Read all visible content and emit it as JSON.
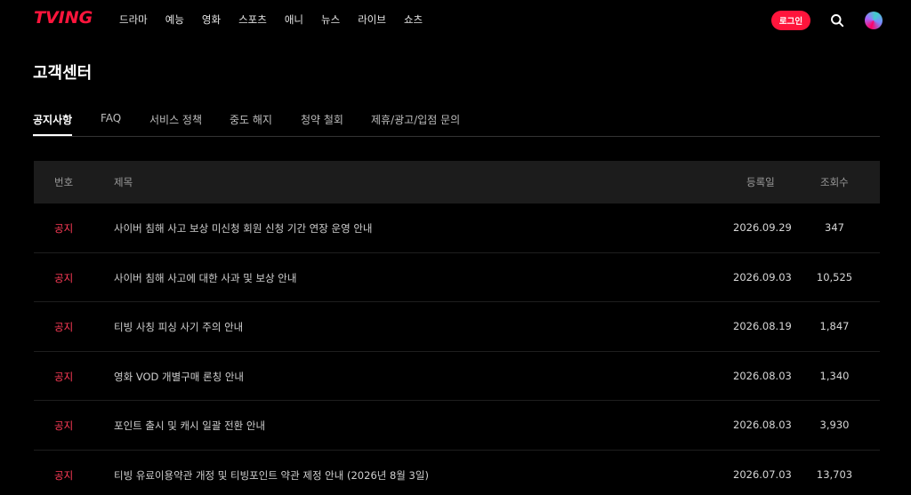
{
  "header": {
    "logo_text": "TVING",
    "nav": [
      "드라마",
      "예능",
      "영화",
      "스포츠",
      "애니",
      "뉴스",
      "라이브",
      "쇼츠"
    ],
    "login_label": "로그인",
    "brand_color": "#ff153c"
  },
  "page_title": "고객센터",
  "tabs": [
    "공지사항",
    "FAQ",
    "서비스 정책",
    "중도 해지",
    "청약 철회",
    "제휴/광고/입점 문의"
  ],
  "table": {
    "headers": {
      "no": "번호",
      "title": "제목",
      "date": "등록일",
      "views": "조회수"
    },
    "rows": [
      {
        "no": "공지",
        "title": "사이버 침해 사고 보상 미신청 회원 신청 기간 연장 운영 안내",
        "date": "2026.09.29",
        "views": "347"
      },
      {
        "no": "공지",
        "title": "사이버 침해 사고에 대한 사과 및 보상 안내",
        "date": "2026.09.03",
        "views": "10,525"
      },
      {
        "no": "공지",
        "title": "티빙 사칭 피싱 사기 주의 안내",
        "date": "2026.08.19",
        "views": "1,847"
      },
      {
        "no": "공지",
        "title": "영화 VOD 개별구매 론칭 안내",
        "date": "2026.08.03",
        "views": "1,340"
      },
      {
        "no": "공지",
        "title": "포인트 출시 및 캐시 일괄 전환 안내",
        "date": "2026.08.03",
        "views": "3,930"
      },
      {
        "no": "공지",
        "title": "티빙 유료이용약관 개정 및 티빙포인트 약관 제정 안내 (2026년 8월 3일)",
        "date": "2026.07.03",
        "views": "13,703"
      }
    ]
  },
  "icons": {
    "search": "search-icon",
    "avatar": "avatar"
  }
}
